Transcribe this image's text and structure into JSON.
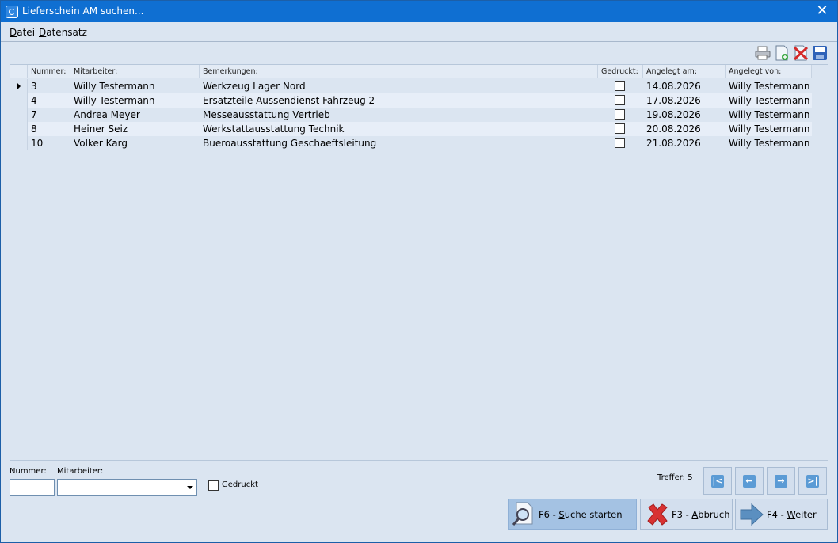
{
  "window": {
    "title": "Lieferschein AM suchen..."
  },
  "menu": [
    "Datei",
    "Datensatz"
  ],
  "toolbar": {
    "icons": [
      "printer-icon",
      "new-document-icon",
      "delete-icon",
      "save-icon"
    ]
  },
  "grid": {
    "columns": [
      "Nummer:",
      "Mitarbeiter:",
      "Bemerkungen:",
      "Gedruckt:",
      "Angelegt am:",
      "Angelegt von:"
    ],
    "rows": [
      {
        "nummer": "3",
        "mitarbeiter": "Willy Testermann",
        "bemerkungen": "Werkzeug Lager Nord",
        "gedruckt": false,
        "angelegt_am": "14.08.2026",
        "angelegt_von": "Willy Testermann"
      },
      {
        "nummer": "4",
        "mitarbeiter": "Willy Testermann",
        "bemerkungen": "Ersatzteile Aussendienst Fahrzeug 2",
        "gedruckt": false,
        "angelegt_am": "17.08.2026",
        "angelegt_von": "Willy Testermann"
      },
      {
        "nummer": "7",
        "mitarbeiter": "Andrea Meyer",
        "bemerkungen": "Messeausstattung Vertrieb",
        "gedruckt": false,
        "angelegt_am": "19.08.2026",
        "angelegt_von": "Willy Testermann"
      },
      {
        "nummer": "8",
        "mitarbeiter": "Heiner Seiz",
        "bemerkungen": "Werkstattausstattung Technik",
        "gedruckt": false,
        "angelegt_am": "20.08.2026",
        "angelegt_von": "Willy Testermann"
      },
      {
        "nummer": "10",
        "mitarbeiter": "Volker Karg",
        "bemerkungen": "Bueroausstattung Geschaeftsleitung",
        "gedruckt": false,
        "angelegt_am": "21.08.2026",
        "angelegt_von": "Willy Testermann"
      }
    ]
  },
  "filter": {
    "nummer_label": "Nummer:",
    "nummer_value": "",
    "mitarbeiter_label": "Mitarbeiter:",
    "mitarbeiter_value": "",
    "gedruckt_label": "Gedruckt"
  },
  "status": {
    "treffer": "Treffer: 5"
  },
  "buttons": {
    "search_key": "F6 - ",
    "search_u": "S",
    "search_rest": "uche starten",
    "cancel_key": "F3 - ",
    "cancel_u": "A",
    "cancel_rest": "bbruch",
    "next_key": "F4 - ",
    "next_u": "W",
    "next_rest": "eiter"
  }
}
